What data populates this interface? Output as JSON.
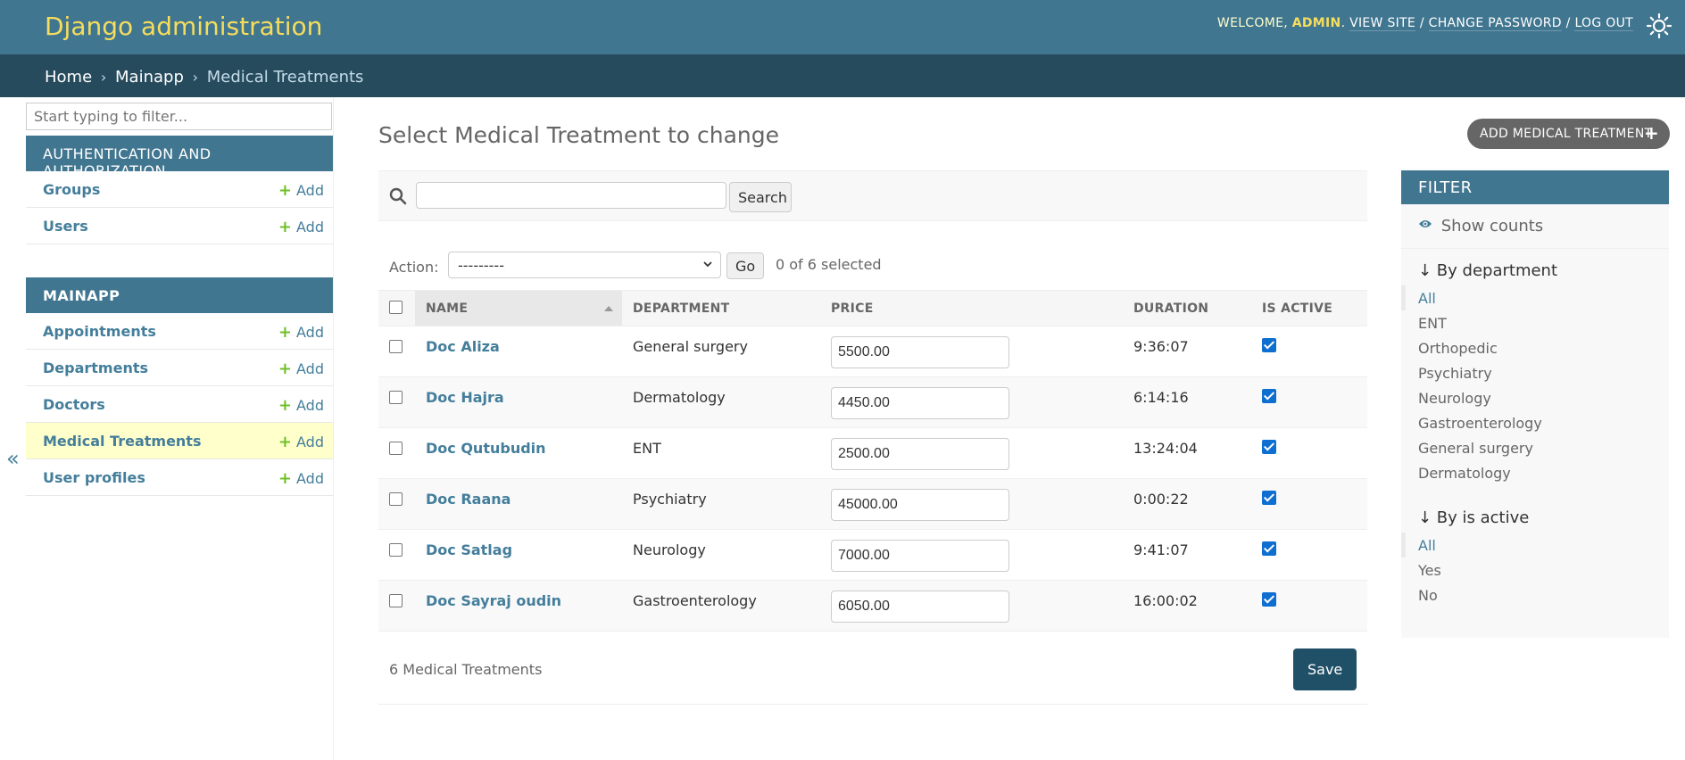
{
  "header": {
    "site_name": "Django administration",
    "welcome": "WELCOME,",
    "user": "ADMIN",
    "view_site": "VIEW SITE",
    "change_password": "CHANGE PASSWORD",
    "log_out": "LOG OUT",
    "sep": "/"
  },
  "breadcrumbs": {
    "home": "Home",
    "app": "Mainapp",
    "current": "Medical Treatments",
    "sep": "›"
  },
  "sidebar": {
    "filter_placeholder": "Start typing to filter...",
    "toggle": "«",
    "modules": [
      {
        "caption": "AUTHENTICATION AND AUTHORIZATION",
        "models": [
          {
            "name": "Groups",
            "add": "Add"
          },
          {
            "name": "Users",
            "add": "Add"
          }
        ]
      },
      {
        "caption": "MAINAPP",
        "models": [
          {
            "name": "Appointments",
            "add": "Add"
          },
          {
            "name": "Departments",
            "add": "Add"
          },
          {
            "name": "Doctors",
            "add": "Add"
          },
          {
            "name": "Medical Treatments",
            "add": "Add"
          },
          {
            "name": "User profiles",
            "add": "Add"
          }
        ]
      }
    ]
  },
  "main": {
    "title": "Select Medical Treatment to change",
    "add_button": "ADD MEDICAL TREATMENT",
    "search_button": "Search",
    "action_label": "Action:",
    "action_value": "---------",
    "go_button": "Go",
    "selected_count": "0 of 6 selected",
    "columns": [
      "NAME",
      "DEPARTMENT",
      "PRICE",
      "DURATION",
      "IS ACTIVE"
    ],
    "rows": [
      {
        "name": "Doc Aliza",
        "department": "General surgery",
        "price": "5500.00",
        "duration": "9:36:07",
        "active": true
      },
      {
        "name": "Doc Hajra",
        "department": "Dermatology",
        "price": "4450.00",
        "duration": "6:14:16",
        "active": true
      },
      {
        "name": "Doc Qutubudin",
        "department": "ENT",
        "price": "2500.00",
        "duration": "13:24:04",
        "active": true
      },
      {
        "name": "Doc Raana",
        "department": "Psychiatry",
        "price": "45000.00",
        "duration": "0:00:22",
        "active": true
      },
      {
        "name": "Doc Satlag",
        "department": "Neurology",
        "price": "7000.00",
        "duration": "9:41:07",
        "active": true
      },
      {
        "name": "Doc Sayraj oudin",
        "department": "Gastroenterology",
        "price": "6050.00",
        "duration": "16:00:02",
        "active": true
      }
    ],
    "result_count": "6 Medical Treatments",
    "save_button": "Save"
  },
  "filter": {
    "title": "FILTER",
    "show_counts": "Show counts",
    "by_department": "↓ By department",
    "department_options": [
      "All",
      "ENT",
      "Orthopedic",
      "Psychiatry",
      "Neurology",
      "Gastroenterology",
      "General surgery",
      "Dermatology"
    ],
    "by_is_active": "↓ By is active",
    "active_options": [
      "All",
      "Yes",
      "No"
    ]
  },
  "colors": {
    "header_bg": "#417690",
    "breadcrumbs_bg": "#264b5d",
    "site_name": "#f5dd5d",
    "link": "#447e9b",
    "selected_row": "#ffffcc",
    "add_plus": "#70bf2b",
    "save_button": "#205067"
  },
  "icons": {
    "theme_toggle": "sun-icon",
    "search": "search-icon",
    "show_counts": "eye-icon",
    "add": "plus-icon",
    "collapse": "double-chevron-left-icon"
  }
}
